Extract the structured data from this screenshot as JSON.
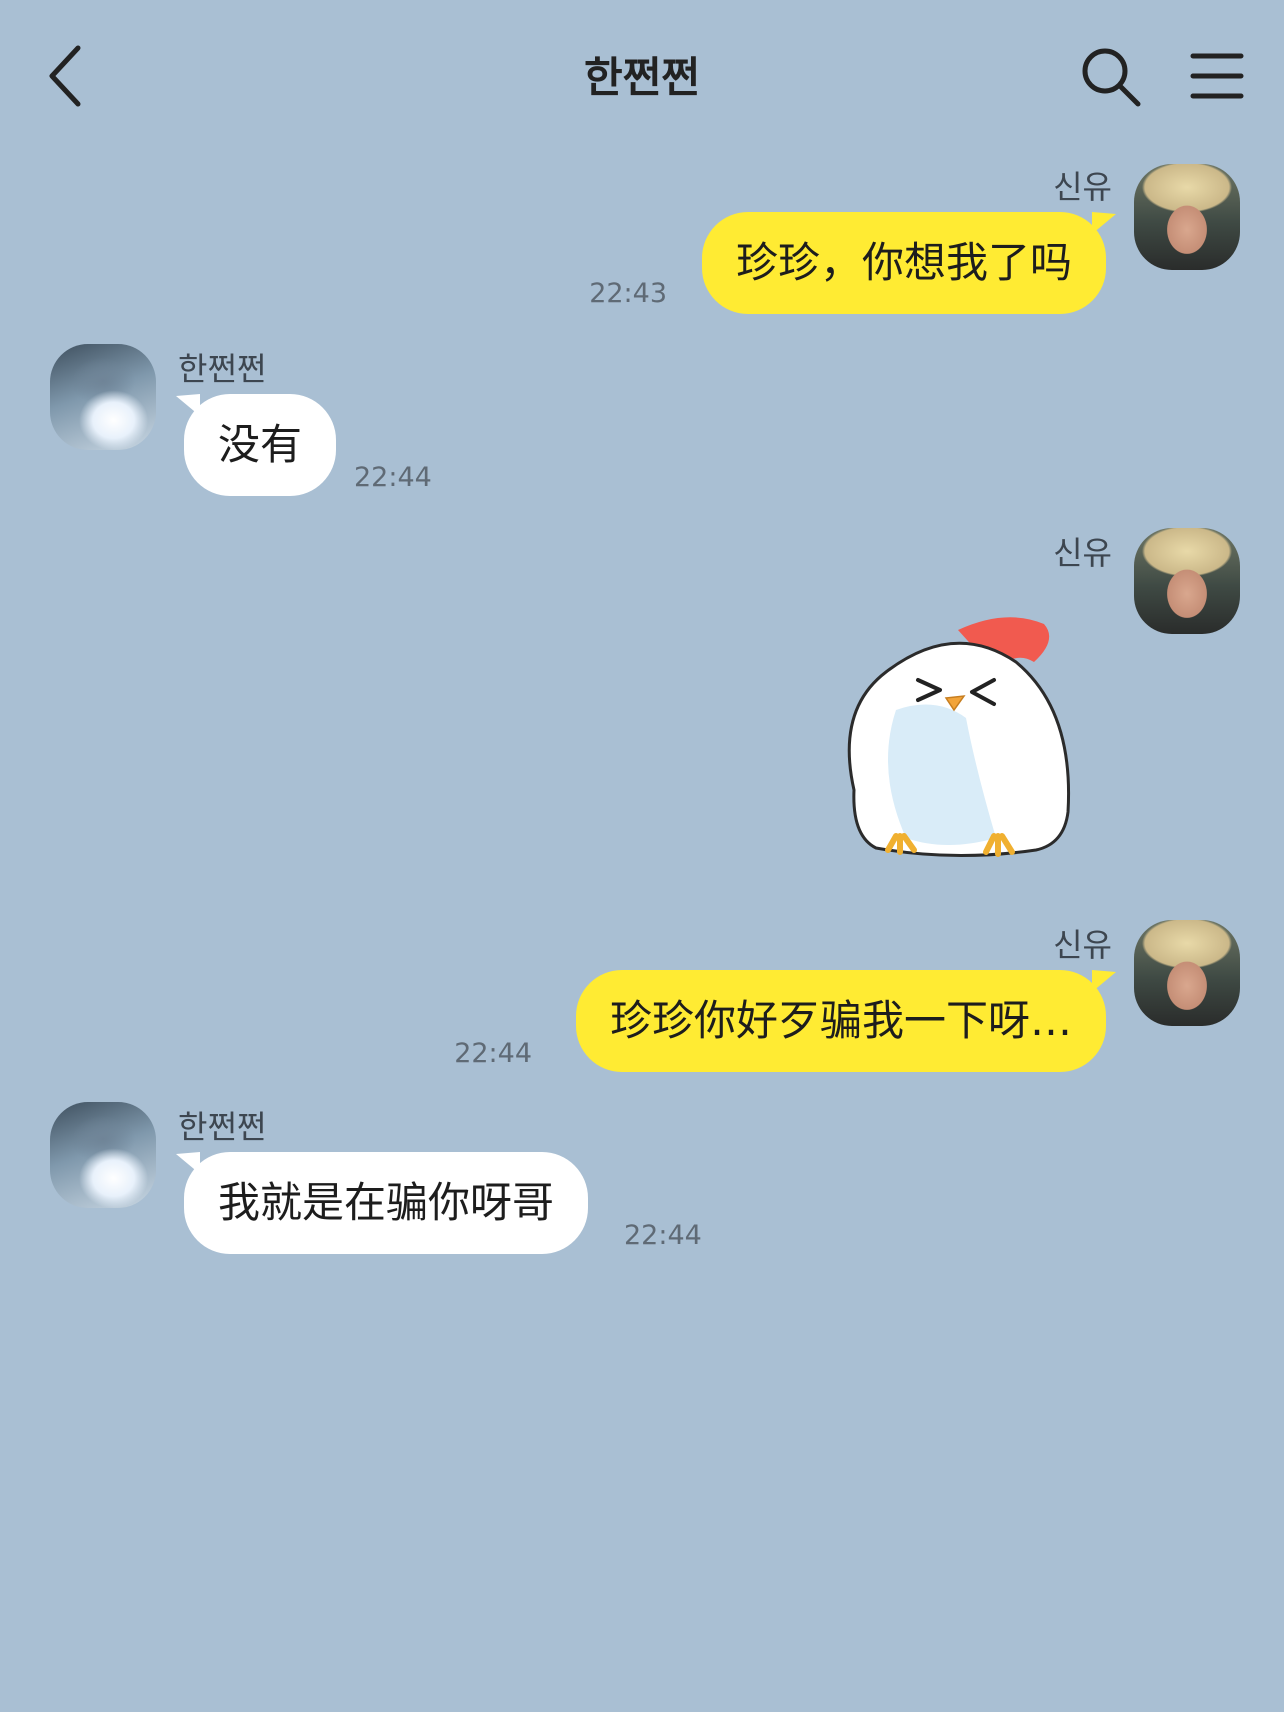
{
  "header": {
    "title": "한쩐쩐",
    "back_icon": "chevron-left-icon",
    "search_icon": "search-icon",
    "menu_icon": "hamburger-menu-icon"
  },
  "colors": {
    "background": "#a9bfd3",
    "my_bubble": "#ffeb33",
    "their_bubble": "#ffffff"
  },
  "messages": [
    {
      "sender": "신유",
      "text": "珍珍，你想我了吗",
      "time": "22:43"
    },
    {
      "sender": "한쩐쩐",
      "text": "没有",
      "time": "22:44"
    },
    {
      "sender": "신유",
      "sticker": "chicken-sticker"
    },
    {
      "sender": "신유",
      "text": "珍珍你好歹骗我一下呀…",
      "time": "22:44"
    },
    {
      "sender": "한쩐쩐",
      "text": "我就是在骗你呀哥",
      "time": "22:44"
    }
  ]
}
